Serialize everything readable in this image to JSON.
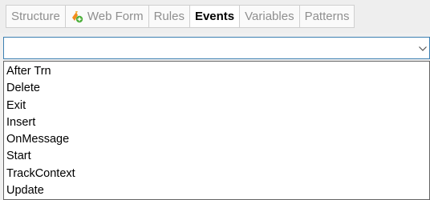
{
  "tabs": [
    {
      "label": "Structure",
      "active": false,
      "icon": null
    },
    {
      "label": "Web Form",
      "active": false,
      "icon": "web-form-icon"
    },
    {
      "label": "Rules",
      "active": false,
      "icon": null
    },
    {
      "label": "Events",
      "active": true,
      "icon": null
    },
    {
      "label": "Variables",
      "active": false,
      "icon": null
    },
    {
      "label": "Patterns",
      "active": false,
      "icon": null
    }
  ],
  "event_selector": {
    "value": "",
    "arrow_icon": "chevron-down-icon",
    "options": [
      "After Trn",
      "Delete",
      "Exit",
      "Insert",
      "OnMessage",
      "Start",
      "TrackContext",
      "Update"
    ]
  },
  "colors": {
    "active_tab_text": "#000000",
    "inactive_tab_text": "#8f8f8f",
    "combo_border": "#3c7fb1",
    "dropdown_border": "#646464",
    "web_form_icon_orange": "#f28c1e",
    "web_form_icon_green": "#4caf3a"
  }
}
